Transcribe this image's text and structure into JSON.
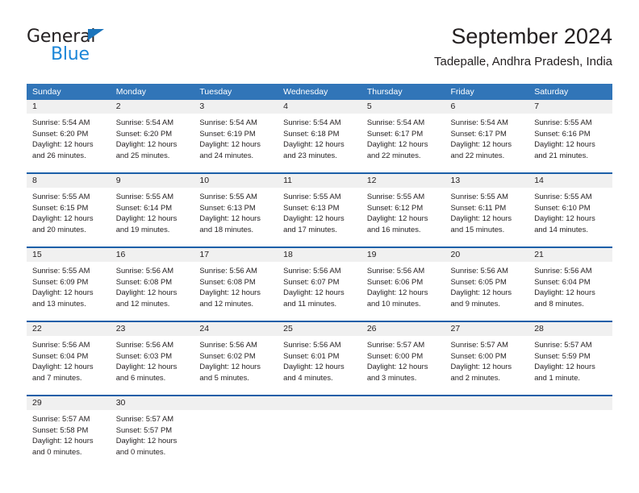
{
  "brand": {
    "name_part1": "General",
    "name_part2": "Blue",
    "triangle_icon": "triangle-icon"
  },
  "header": {
    "title": "September 2024",
    "subtitle": "Tadepalle, Andhra Pradesh, India"
  },
  "colors": {
    "header_blue": "#3175b8",
    "separator_blue": "#1b5fa8",
    "daynum_band": "#f0f0f0",
    "brand_blue": "#1b86d8",
    "text": "#231f20"
  },
  "weekday_headers": [
    "Sunday",
    "Monday",
    "Tuesday",
    "Wednesday",
    "Thursday",
    "Friday",
    "Saturday"
  ],
  "weeks": [
    [
      {
        "day": "1",
        "sunrise": "Sunrise: 5:54 AM",
        "sunset": "Sunset: 6:20 PM",
        "daylight1": "Daylight: 12 hours",
        "daylight2": "and 26 minutes."
      },
      {
        "day": "2",
        "sunrise": "Sunrise: 5:54 AM",
        "sunset": "Sunset: 6:20 PM",
        "daylight1": "Daylight: 12 hours",
        "daylight2": "and 25 minutes."
      },
      {
        "day": "3",
        "sunrise": "Sunrise: 5:54 AM",
        "sunset": "Sunset: 6:19 PM",
        "daylight1": "Daylight: 12 hours",
        "daylight2": "and 24 minutes."
      },
      {
        "day": "4",
        "sunrise": "Sunrise: 5:54 AM",
        "sunset": "Sunset: 6:18 PM",
        "daylight1": "Daylight: 12 hours",
        "daylight2": "and 23 minutes."
      },
      {
        "day": "5",
        "sunrise": "Sunrise: 5:54 AM",
        "sunset": "Sunset: 6:17 PM",
        "daylight1": "Daylight: 12 hours",
        "daylight2": "and 22 minutes."
      },
      {
        "day": "6",
        "sunrise": "Sunrise: 5:54 AM",
        "sunset": "Sunset: 6:17 PM",
        "daylight1": "Daylight: 12 hours",
        "daylight2": "and 22 minutes."
      },
      {
        "day": "7",
        "sunrise": "Sunrise: 5:55 AM",
        "sunset": "Sunset: 6:16 PM",
        "daylight1": "Daylight: 12 hours",
        "daylight2": "and 21 minutes."
      }
    ],
    [
      {
        "day": "8",
        "sunrise": "Sunrise: 5:55 AM",
        "sunset": "Sunset: 6:15 PM",
        "daylight1": "Daylight: 12 hours",
        "daylight2": "and 20 minutes."
      },
      {
        "day": "9",
        "sunrise": "Sunrise: 5:55 AM",
        "sunset": "Sunset: 6:14 PM",
        "daylight1": "Daylight: 12 hours",
        "daylight2": "and 19 minutes."
      },
      {
        "day": "10",
        "sunrise": "Sunrise: 5:55 AM",
        "sunset": "Sunset: 6:13 PM",
        "daylight1": "Daylight: 12 hours",
        "daylight2": "and 18 minutes."
      },
      {
        "day": "11",
        "sunrise": "Sunrise: 5:55 AM",
        "sunset": "Sunset: 6:13 PM",
        "daylight1": "Daylight: 12 hours",
        "daylight2": "and 17 minutes."
      },
      {
        "day": "12",
        "sunrise": "Sunrise: 5:55 AM",
        "sunset": "Sunset: 6:12 PM",
        "daylight1": "Daylight: 12 hours",
        "daylight2": "and 16 minutes."
      },
      {
        "day": "13",
        "sunrise": "Sunrise: 5:55 AM",
        "sunset": "Sunset: 6:11 PM",
        "daylight1": "Daylight: 12 hours",
        "daylight2": "and 15 minutes."
      },
      {
        "day": "14",
        "sunrise": "Sunrise: 5:55 AM",
        "sunset": "Sunset: 6:10 PM",
        "daylight1": "Daylight: 12 hours",
        "daylight2": "and 14 minutes."
      }
    ],
    [
      {
        "day": "15",
        "sunrise": "Sunrise: 5:55 AM",
        "sunset": "Sunset: 6:09 PM",
        "daylight1": "Daylight: 12 hours",
        "daylight2": "and 13 minutes."
      },
      {
        "day": "16",
        "sunrise": "Sunrise: 5:56 AM",
        "sunset": "Sunset: 6:08 PM",
        "daylight1": "Daylight: 12 hours",
        "daylight2": "and 12 minutes."
      },
      {
        "day": "17",
        "sunrise": "Sunrise: 5:56 AM",
        "sunset": "Sunset: 6:08 PM",
        "daylight1": "Daylight: 12 hours",
        "daylight2": "and 12 minutes."
      },
      {
        "day": "18",
        "sunrise": "Sunrise: 5:56 AM",
        "sunset": "Sunset: 6:07 PM",
        "daylight1": "Daylight: 12 hours",
        "daylight2": "and 11 minutes."
      },
      {
        "day": "19",
        "sunrise": "Sunrise: 5:56 AM",
        "sunset": "Sunset: 6:06 PM",
        "daylight1": "Daylight: 12 hours",
        "daylight2": "and 10 minutes."
      },
      {
        "day": "20",
        "sunrise": "Sunrise: 5:56 AM",
        "sunset": "Sunset: 6:05 PM",
        "daylight1": "Daylight: 12 hours",
        "daylight2": "and 9 minutes."
      },
      {
        "day": "21",
        "sunrise": "Sunrise: 5:56 AM",
        "sunset": "Sunset: 6:04 PM",
        "daylight1": "Daylight: 12 hours",
        "daylight2": "and 8 minutes."
      }
    ],
    [
      {
        "day": "22",
        "sunrise": "Sunrise: 5:56 AM",
        "sunset": "Sunset: 6:04 PM",
        "daylight1": "Daylight: 12 hours",
        "daylight2": "and 7 minutes."
      },
      {
        "day": "23",
        "sunrise": "Sunrise: 5:56 AM",
        "sunset": "Sunset: 6:03 PM",
        "daylight1": "Daylight: 12 hours",
        "daylight2": "and 6 minutes."
      },
      {
        "day": "24",
        "sunrise": "Sunrise: 5:56 AM",
        "sunset": "Sunset: 6:02 PM",
        "daylight1": "Daylight: 12 hours",
        "daylight2": "and 5 minutes."
      },
      {
        "day": "25",
        "sunrise": "Sunrise: 5:56 AM",
        "sunset": "Sunset: 6:01 PM",
        "daylight1": "Daylight: 12 hours",
        "daylight2": "and 4 minutes."
      },
      {
        "day": "26",
        "sunrise": "Sunrise: 5:57 AM",
        "sunset": "Sunset: 6:00 PM",
        "daylight1": "Daylight: 12 hours",
        "daylight2": "and 3 minutes."
      },
      {
        "day": "27",
        "sunrise": "Sunrise: 5:57 AM",
        "sunset": "Sunset: 6:00 PM",
        "daylight1": "Daylight: 12 hours",
        "daylight2": "and 2 minutes."
      },
      {
        "day": "28",
        "sunrise": "Sunrise: 5:57 AM",
        "sunset": "Sunset: 5:59 PM",
        "daylight1": "Daylight: 12 hours",
        "daylight2": "and 1 minute."
      }
    ],
    [
      {
        "day": "29",
        "sunrise": "Sunrise: 5:57 AM",
        "sunset": "Sunset: 5:58 PM",
        "daylight1": "Daylight: 12 hours",
        "daylight2": "and 0 minutes."
      },
      {
        "day": "30",
        "sunrise": "Sunrise: 5:57 AM",
        "sunset": "Sunset: 5:57 PM",
        "daylight1": "Daylight: 12 hours",
        "daylight2": "and 0 minutes."
      },
      {
        "day": "",
        "sunrise": "",
        "sunset": "",
        "daylight1": "",
        "daylight2": ""
      },
      {
        "day": "",
        "sunrise": "",
        "sunset": "",
        "daylight1": "",
        "daylight2": ""
      },
      {
        "day": "",
        "sunrise": "",
        "sunset": "",
        "daylight1": "",
        "daylight2": ""
      },
      {
        "day": "",
        "sunrise": "",
        "sunset": "",
        "daylight1": "",
        "daylight2": ""
      },
      {
        "day": "",
        "sunrise": "",
        "sunset": "",
        "daylight1": "",
        "daylight2": ""
      }
    ]
  ]
}
